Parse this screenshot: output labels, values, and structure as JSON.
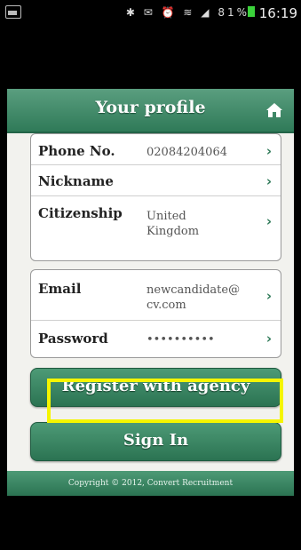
{
  "status_bar": {
    "icons": "✱ ✉ ⏰ ≋ ◢ 81%",
    "time": "16:19"
  },
  "header": {
    "title": "Your profile"
  },
  "profile": [
    {
      "label": "Phone No.",
      "value": "02084204064"
    },
    {
      "label": "Nickname",
      "value": ""
    },
    {
      "label": "Citizenship",
      "value_line1": "United",
      "value_line2": "Kingdom"
    }
  ],
  "account": {
    "email_label": "Email",
    "email_line1": "newcandidate@",
    "email_line2": "cv.com",
    "password_label": "Password",
    "password_value": "••••••••••"
  },
  "buttons": {
    "register": "Register with agency",
    "sign_in": "Sign In"
  },
  "footer": "Copyright © 2012, Convert Recruitment",
  "chevron": "›"
}
